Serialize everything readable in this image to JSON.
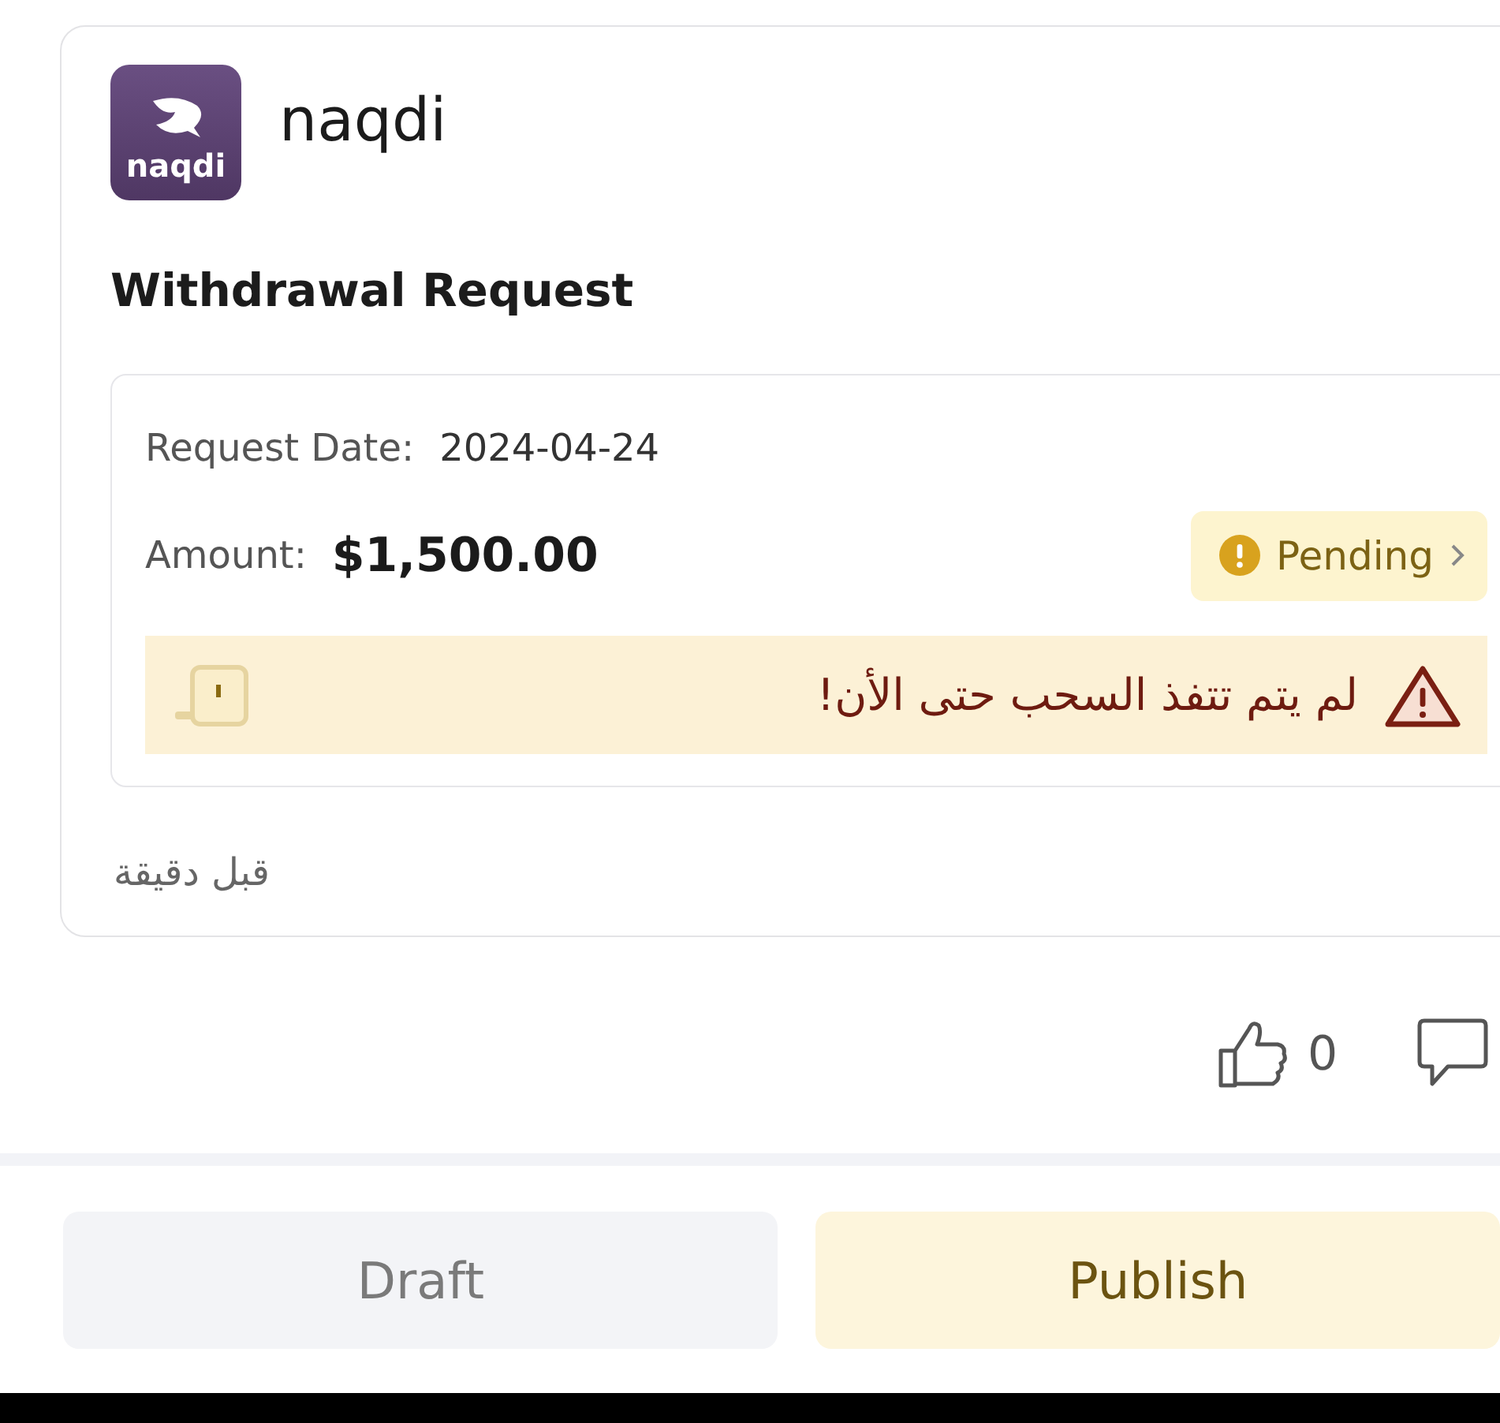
{
  "app": {
    "logo_text": "naqdi",
    "name": "naqdi"
  },
  "post_title": "Withdrawal Request",
  "request": {
    "date_label": "Request Date:",
    "date": "2024-04-24",
    "amount_label": "Amount:",
    "amount": "$1,500.00",
    "status": "Pending",
    "warning": "لم يتم تتفذ السحب حتى الأن!"
  },
  "time": "قبل دقيقة",
  "likes": "0",
  "buttons": [
    {
      "label": "Draft",
      "kind": "secondary"
    },
    {
      "label": "Publish",
      "kind": "primary"
    }
  ]
}
